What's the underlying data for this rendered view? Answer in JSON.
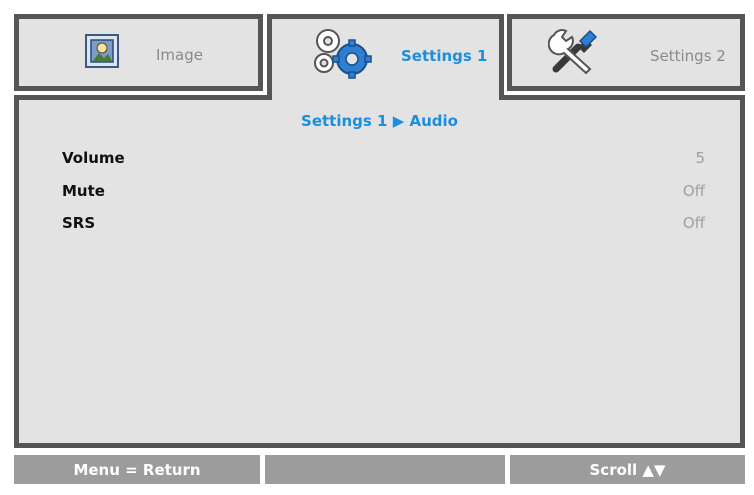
{
  "tabs": [
    {
      "label": "Image",
      "icon": "image-icon",
      "active": false
    },
    {
      "label": "Settings 1",
      "icon": "gears-icon",
      "active": true
    },
    {
      "label": "Settings 2",
      "icon": "tools-icon",
      "active": false
    }
  ],
  "breadcrumb": "Settings 1 ▶ Audio",
  "rows": [
    {
      "label": "Volume",
      "value": "5"
    },
    {
      "label": "Mute",
      "value": "Off"
    },
    {
      "label": "SRS",
      "value": "Off"
    }
  ],
  "footer": {
    "left": "Menu = Return",
    "middle": "",
    "right": "Scroll ▲▼"
  },
  "colors": {
    "accent": "#1a8fe0",
    "border": "#555555",
    "panel_bg": "#e3e3e3",
    "footer_bg": "#9c9c9c"
  }
}
